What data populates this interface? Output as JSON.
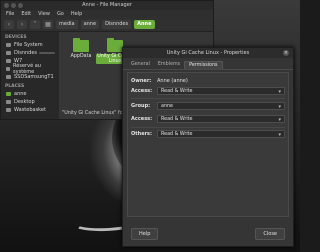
{
  "file_manager": {
    "title": "Anne - File Manager",
    "menu": [
      "File",
      "Edit",
      "View",
      "Go",
      "Help"
    ],
    "breadcrumbs": [
      "media",
      "anne",
      "Disnndes",
      "Anne"
    ],
    "sidebar": {
      "devices_heading": "DEVICES",
      "devices": [
        "File System",
        "Disnndes",
        "W7",
        "Réservé au système",
        "SSDSamsungT1"
      ],
      "places_heading": "PLACES",
      "places": [
        "anne",
        "Desktop",
        "Wastebasket"
      ]
    },
    "folders": [
      "AppData",
      "Unity Gi Cache Linux"
    ],
    "status": "\"Unity Gi Cache Linux\" fo"
  },
  "properties": {
    "title": "Unity Gi Cache Linux - Properties",
    "tabs": [
      "General",
      "Emblems",
      "Permissions"
    ],
    "owner_label": "Owner:",
    "owner_value": "Anne (anne)",
    "access_label": "Access:",
    "owner_access": "Read & Write",
    "group_label": "Group:",
    "group_value": "anne",
    "group_access": "Read & Write",
    "others_label": "Others:",
    "others_access": "Read & Write",
    "help_button": "Help",
    "close_button": "Close"
  },
  "colors": {
    "accent": "#6bad3a",
    "dialog_bg": "#353535"
  }
}
